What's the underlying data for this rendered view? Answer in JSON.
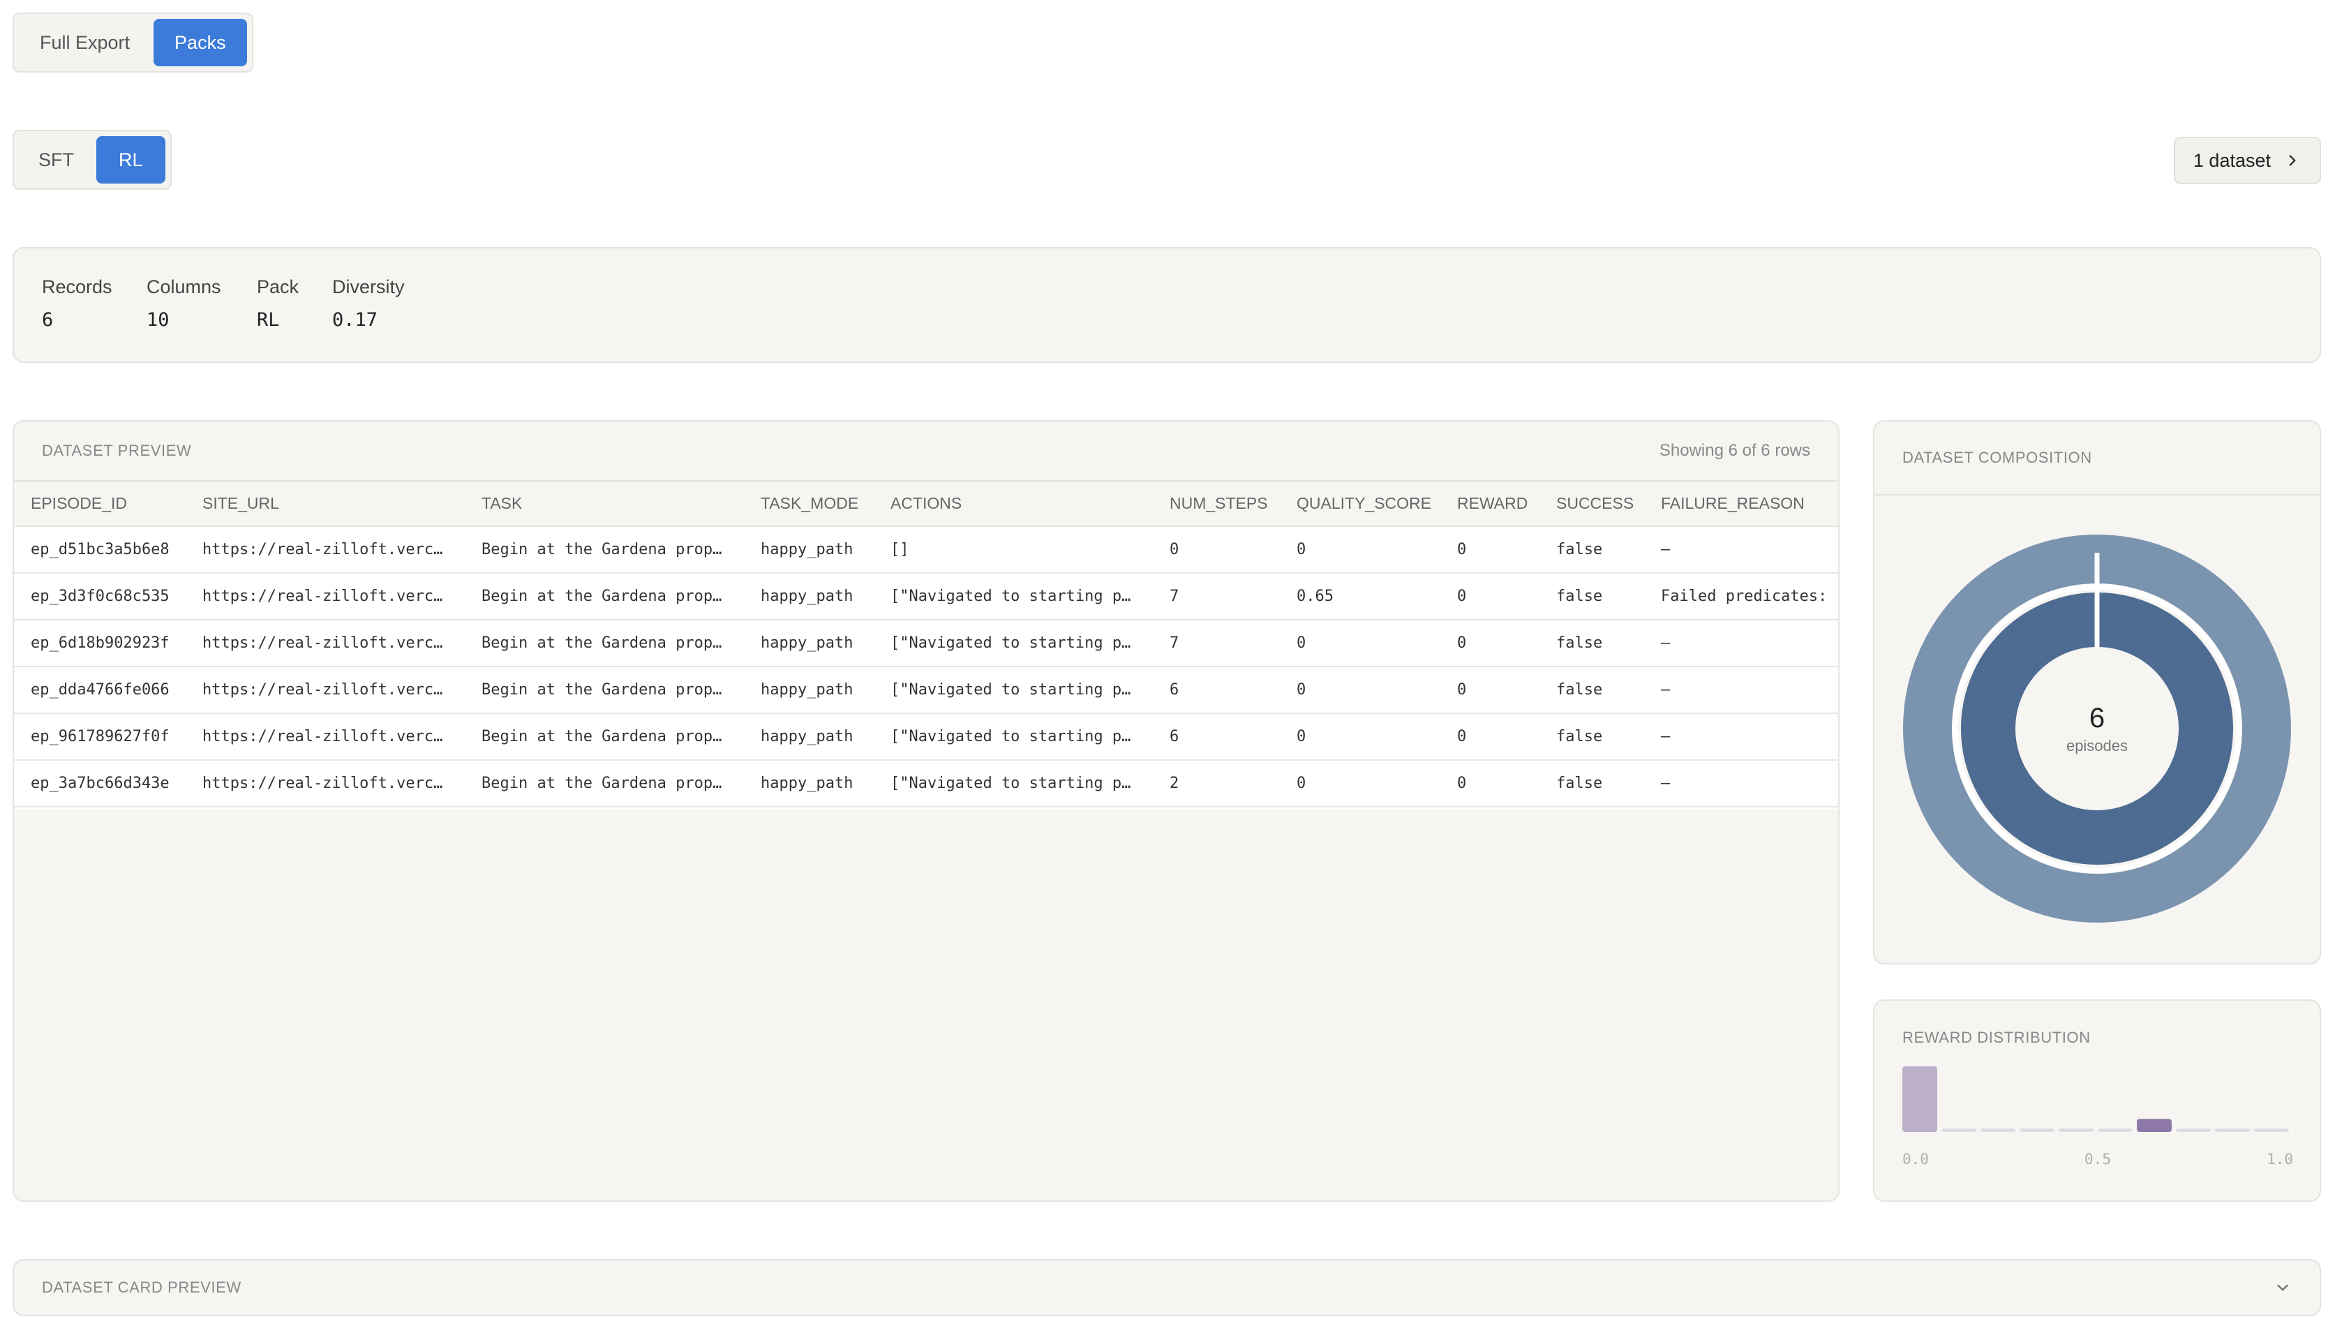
{
  "export_tabs": {
    "full_export": "Full Export",
    "packs": "Packs",
    "active": "Packs"
  },
  "pack_tabs": {
    "sft": "SFT",
    "rl": "RL",
    "active": "RL"
  },
  "dataset_button": {
    "label": "1 dataset",
    "icon": "chevron-right-icon"
  },
  "stats": [
    {
      "label": "Records",
      "value": "6"
    },
    {
      "label": "Columns",
      "value": "10"
    },
    {
      "label": "Pack",
      "value": "RL"
    },
    {
      "label": "Diversity",
      "value": "0.17"
    }
  ],
  "preview": {
    "title": "DATASET PREVIEW",
    "showing": "Showing 6 of 6 rows",
    "columns": [
      "EPISODE_ID",
      "SITE_URL",
      "TASK",
      "TASK_MODE",
      "ACTIONS",
      "NUM_STEPS",
      "QUALITY_SCORE",
      "REWARD",
      "SUCCESS",
      "FAILURE_REASON"
    ],
    "rows": [
      [
        "ep_d51bc3a5b6e8",
        "https://real-zilloft.verc…",
        "Begin at the Gardena prop…",
        "happy_path",
        "[]",
        "0",
        "0",
        "0",
        "false",
        "—"
      ],
      [
        "ep_3d3f0c68c535",
        "https://real-zilloft.verc…",
        "Begin at the Gardena prop…",
        "happy_path",
        "[\"Navigated to starting p…",
        "7",
        "0.65",
        "0",
        "false",
        "Failed predicates: "
      ],
      [
        "ep_6d18b902923f",
        "https://real-zilloft.verc…",
        "Begin at the Gardena prop…",
        "happy_path",
        "[\"Navigated to starting p…",
        "7",
        "0",
        "0",
        "false",
        "—"
      ],
      [
        "ep_dda4766fe066",
        "https://real-zilloft.verc…",
        "Begin at the Gardena prop…",
        "happy_path",
        "[\"Navigated to starting p…",
        "6",
        "0",
        "0",
        "false",
        "—"
      ],
      [
        "ep_961789627f0f",
        "https://real-zilloft.verc…",
        "Begin at the Gardena prop…",
        "happy_path",
        "[\"Navigated to starting p…",
        "6",
        "0",
        "0",
        "false",
        "—"
      ],
      [
        "ep_3a7bc66d343e",
        "https://real-zilloft.verc…",
        "Begin at the Gardena prop…",
        "happy_path",
        "[\"Navigated to starting p…",
        "2",
        "0",
        "0",
        "false",
        "—"
      ]
    ]
  },
  "composition": {
    "title": "DATASET COMPOSITION",
    "center_value": "6",
    "center_label": "episodes",
    "colors": {
      "outer": "#7a93ae",
      "inner": "#4e6b91"
    }
  },
  "reward_distribution": {
    "title": "REWARD DISTRIBUTION",
    "tick_labels": [
      "0.0",
      "0.5",
      "1.0"
    ],
    "colors": {
      "low": "#bcb0c9",
      "mid": "#8e78a8",
      "empty": "#dedbe2"
    }
  },
  "card_preview": {
    "title": "DATASET CARD PREVIEW",
    "icon": "chevron-down-icon"
  },
  "chart_data": {
    "type": "bar",
    "title": "REWARD DISTRIBUTION",
    "categories": [
      "0.0",
      "0.1",
      "0.2",
      "0.3",
      "0.4",
      "0.5",
      "0.6",
      "0.7",
      "0.8",
      "0.9"
    ],
    "values": [
      5,
      0,
      0,
      0,
      0,
      0,
      1,
      0,
      0,
      0
    ],
    "xlim": [
      0,
      1
    ],
    "tick_labels": [
      "0.0",
      "0.5",
      "1.0"
    ]
  }
}
